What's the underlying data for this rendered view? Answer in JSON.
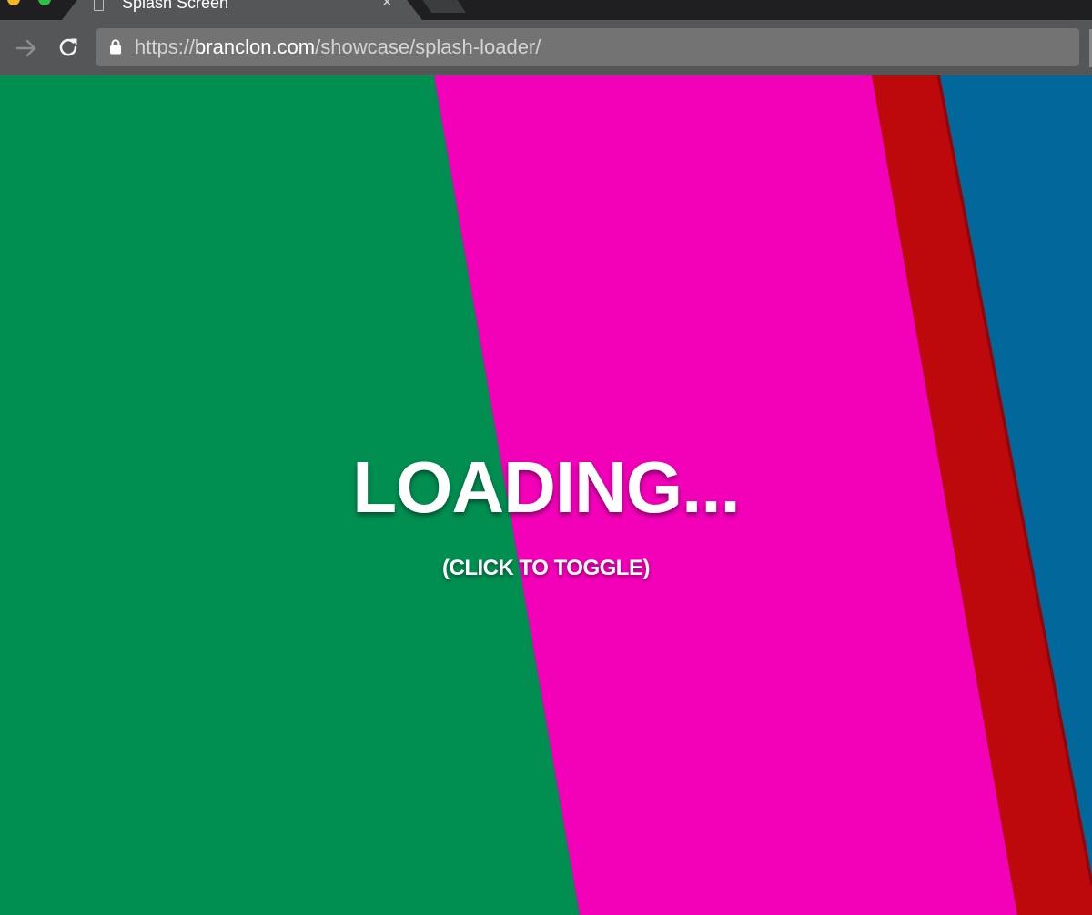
{
  "browser": {
    "tab": {
      "title": "Splash Screen",
      "close_glyph": "×",
      "icon": "page-icon"
    },
    "traffic_lights": [
      "#f5b625",
      "#2fbe46"
    ],
    "address_bar": {
      "scheme": "https://",
      "host": "branclon.com",
      "path": "/showcase/splash-loader/",
      "secure_icon": "lock-icon"
    },
    "nav_icons": [
      "forward-arrow-icon",
      "reload-icon"
    ]
  },
  "page": {
    "title": "LOADING...",
    "hint": "(CLICK TO TOGGLE)",
    "colors": {
      "green": "#008f51",
      "magenta": "#f300b9",
      "red": "#be090c",
      "blue": "#02689c"
    }
  }
}
